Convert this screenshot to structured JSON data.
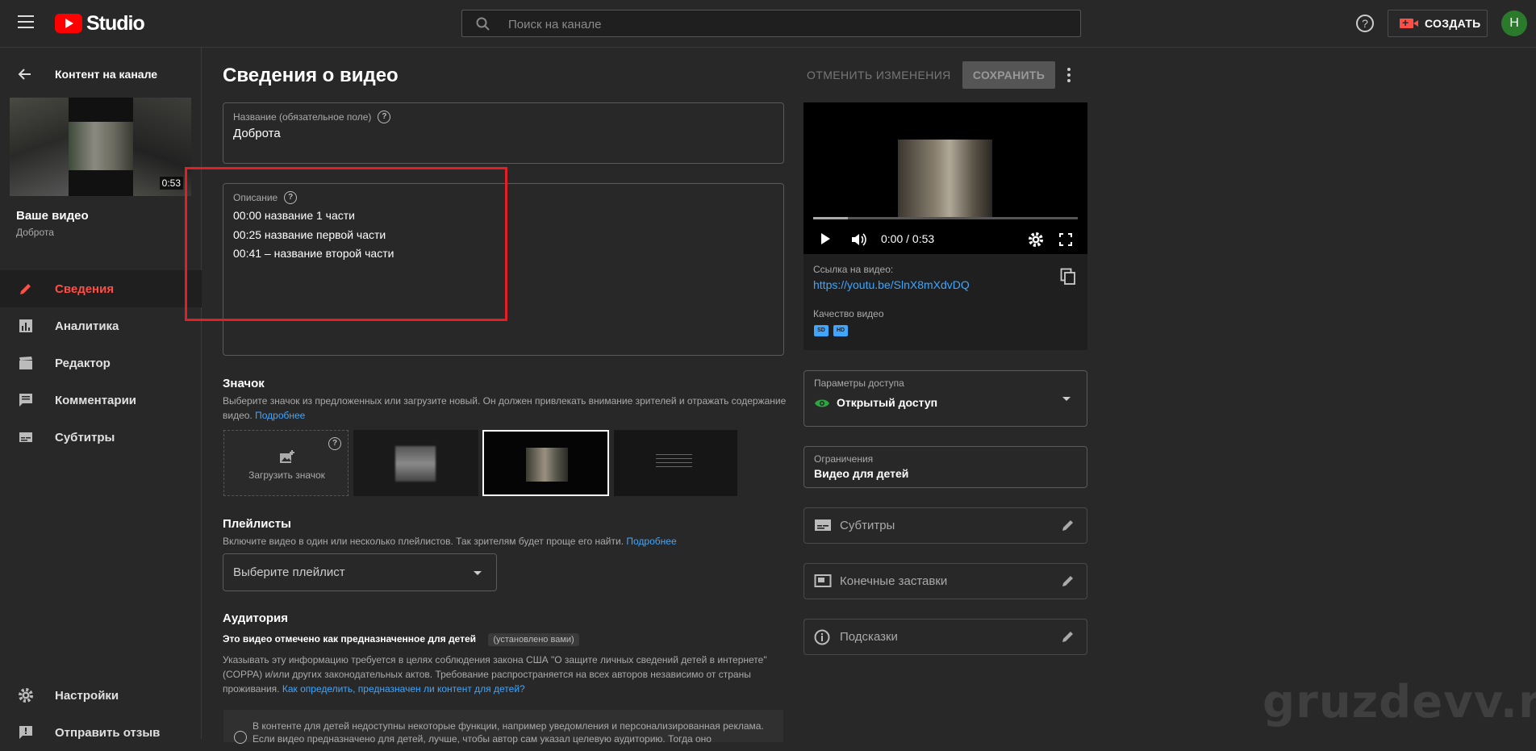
{
  "header": {
    "logo_text": "Studio",
    "search_placeholder": "Поиск на канале",
    "create_label": "СОЗДАТЬ",
    "avatar_letter": "Н",
    "help_glyph": "?"
  },
  "sidebar": {
    "back_title": "Контент на канале",
    "thumb_duration": "0:53",
    "your_video": "Ваше видео",
    "your_video_title": "Доброта",
    "nav": [
      {
        "label": "Сведения",
        "icon": "pencil-icon",
        "active": true
      },
      {
        "label": "Аналитика",
        "icon": "analytics-icon"
      },
      {
        "label": "Редактор",
        "icon": "clapperboard-icon"
      },
      {
        "label": "Комментарии",
        "icon": "comments-icon"
      },
      {
        "label": "Субтитры",
        "icon": "subtitles-icon"
      }
    ],
    "bottom": [
      {
        "label": "Настройки",
        "icon": "gear-icon"
      },
      {
        "label": "Отправить отзыв",
        "icon": "feedback-icon"
      }
    ]
  },
  "main": {
    "title": "Сведения о видео",
    "undo_label": "ОТМЕНИТЬ ИЗМЕНЕНИЯ",
    "save_label": "СОХРАНИТЬ",
    "title_field": {
      "label": "Название (обязательное поле)",
      "value": "Доброта"
    },
    "description": {
      "label": "Описание",
      "lines": [
        "00:00  название 1 части",
        "00:25  название первой части",
        "00:41 – название второй части"
      ]
    },
    "thumbnail": {
      "title": "Значок",
      "text": "Выберите значок из предложенных или загрузите новый. Он должен привлекать внимание зрителей и отражать содержание видео.",
      "more": "Подробнее",
      "upload_label": "Загрузить значок"
    },
    "playlists": {
      "title": "Плейлисты",
      "text": "Включите видео в один или несколько плейлистов. Так зрителям будет проще его найти.",
      "more": "Подробнее",
      "select_placeholder": "Выберите плейлист"
    },
    "audience": {
      "title": "Аудитория",
      "marked": "Это видео отмечено как предназначенное для детей",
      "badge": "(установлено вами)",
      "text": "Указывать эту информацию требуется в целях соблюдения закона США \"О защите личных сведений детей в интернете\" (COPPA) и/или других законодательных актов. Требование распространяется на всех авторов независимо от страны проживания.",
      "link": "Как определить, предназначен ли контент для детей?",
      "info": "В контенте для детей недоступны некоторые функции, например уведомления и персонализированная реклама. Если видео предназначено для детей, лучше, чтобы автор сам указал целевую аудиторию. Тогда оно"
    }
  },
  "panel": {
    "time": "0:00 / 0:53",
    "progress_fraction": 0.13,
    "link_label": "Ссылка на видео:",
    "link": "https://youtu.be/SlnX8mXdvDQ",
    "quality_label": "Качество видео",
    "quality_badges": [
      "SD",
      "HD"
    ],
    "access": {
      "label": "Параметры доступа",
      "value": "Открытый доступ"
    },
    "restrictions": {
      "label": "Ограничения",
      "value": "Видео для детей"
    },
    "extras": [
      "Субтитры",
      "Конечные заставки",
      "Подсказки"
    ]
  },
  "watermark": "gruzdevv.ru",
  "colors": {
    "accent_red": "#ff4e45",
    "link_blue": "#3ea6ff",
    "highlight_box": "#e31e25",
    "access_green": "#2ba640"
  }
}
